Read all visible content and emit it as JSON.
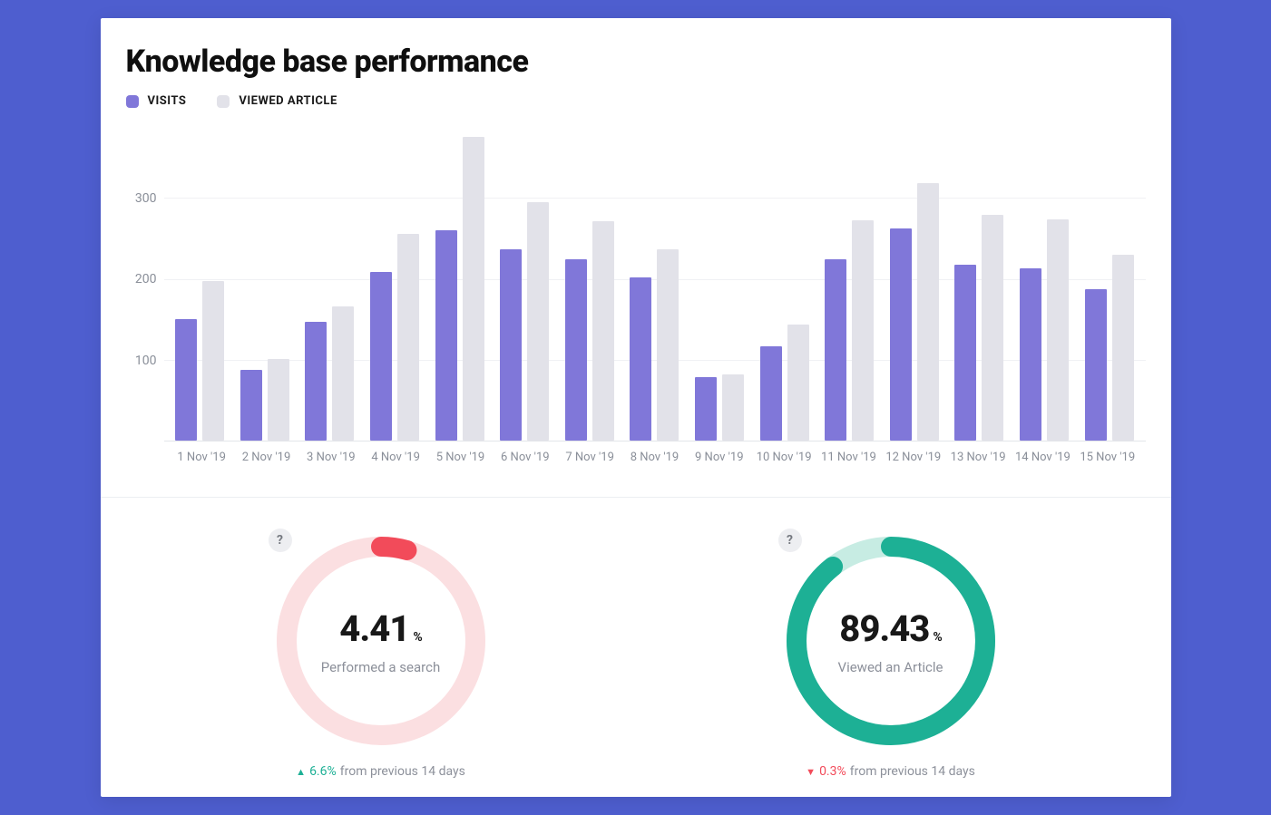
{
  "page_title": "Knowledge base performance",
  "legend": {
    "visits": {
      "label": "VISITS",
      "color": "#8077d9"
    },
    "viewed": {
      "label": "VIEWED ARTICLE",
      "color": "#e2e2e9"
    }
  },
  "chart_data": {
    "type": "bar",
    "title": "Knowledge base performance",
    "xlabel": "",
    "ylabel": "",
    "ylim": [
      0,
      380
    ],
    "yticks": [
      100,
      200,
      300
    ],
    "categories": [
      "1 Nov '19",
      "2 Nov '19",
      "3 Nov '19",
      "4 Nov '19",
      "5 Nov '19",
      "6 Nov '19",
      "7 Nov '19",
      "8 Nov '19",
      "9 Nov '19",
      "10 Nov '19",
      "11 Nov '19",
      "12 Nov '19",
      "13 Nov '19",
      "14 Nov '19",
      "15 Nov '19"
    ],
    "series": [
      {
        "name": "VISITS",
        "color": "#8077d9",
        "values": [
          150,
          87,
          147,
          208,
          260,
          237,
          224,
          202,
          78,
          117,
          224,
          262,
          218,
          213,
          187
        ]
      },
      {
        "name": "VIEWED ARTICLE",
        "color": "#e2e2e9",
        "values": [
          197,
          101,
          166,
          256,
          375,
          295,
          271,
          236,
          82,
          144,
          272,
          318,
          279,
          273,
          230
        ]
      }
    ]
  },
  "donuts": {
    "search": {
      "value": "4.41",
      "pct_symbol": "%",
      "label": "Performed a search",
      "percent_fill": 4.41,
      "track_color": "#fbdfe1",
      "fill_color": "#f24b5a",
      "delta_direction": "up",
      "delta_value": "6.6%",
      "delta_suffix": "from previous 14 days"
    },
    "article": {
      "value": "89.43",
      "pct_symbol": "%",
      "label": "Viewed an Article",
      "percent_fill": 89.43,
      "track_color": "#c7ece3",
      "fill_color": "#1db095",
      "delta_direction": "down",
      "delta_value": "0.3%",
      "delta_suffix": "from previous 14 days"
    }
  },
  "help_icon_char": "?"
}
